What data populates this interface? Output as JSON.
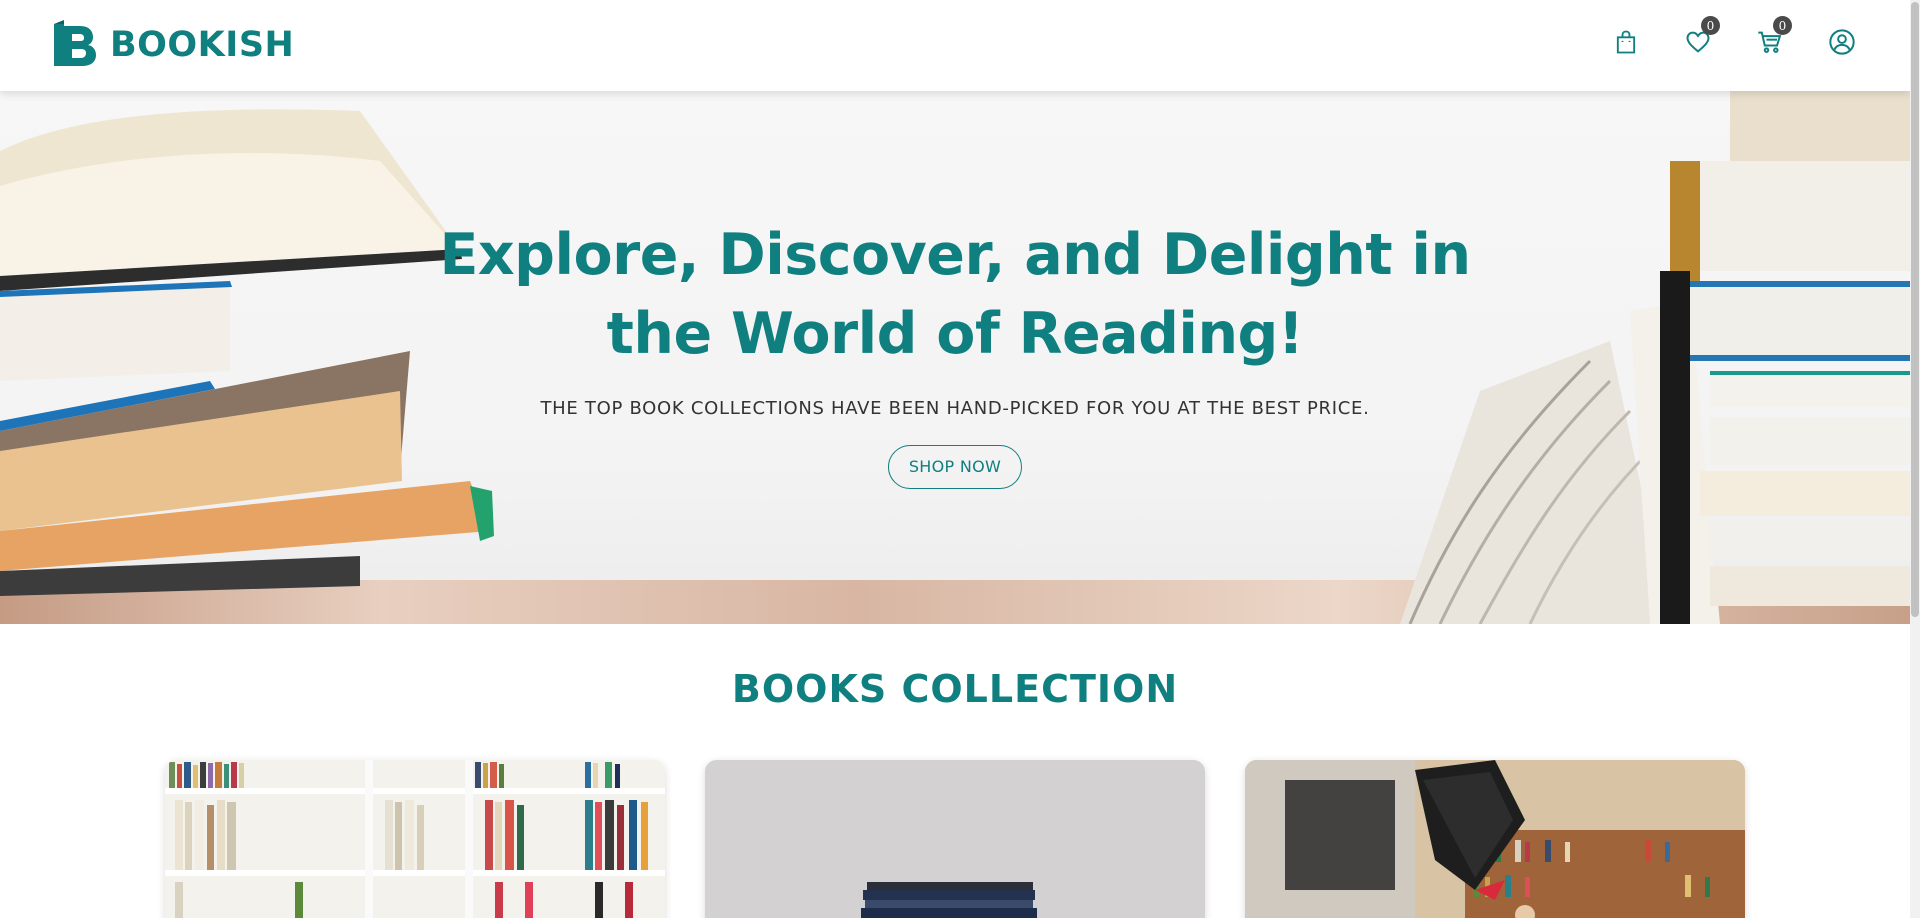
{
  "brand": {
    "name": "BOOKISH",
    "accent": "#0f7f7f"
  },
  "header": {
    "icons": [
      {
        "name": "shopping-bag-icon",
        "badge": null
      },
      {
        "name": "heart-icon",
        "badge": "0"
      },
      {
        "name": "cart-icon",
        "badge": "0"
      },
      {
        "name": "user-icon",
        "badge": null
      }
    ],
    "wishlist_count": "0",
    "cart_count": "0"
  },
  "hero": {
    "title_line1": "Explore, Discover, and Delight in",
    "title_line2": "the World of Reading!",
    "subtitle": "THE TOP BOOK COLLECTIONS HAVE BEEN HAND-PICKED FOR YOU AT THE BEST PRICE.",
    "cta_label": "SHOP NOW"
  },
  "collection": {
    "title": "BOOKS COLLECTION"
  }
}
